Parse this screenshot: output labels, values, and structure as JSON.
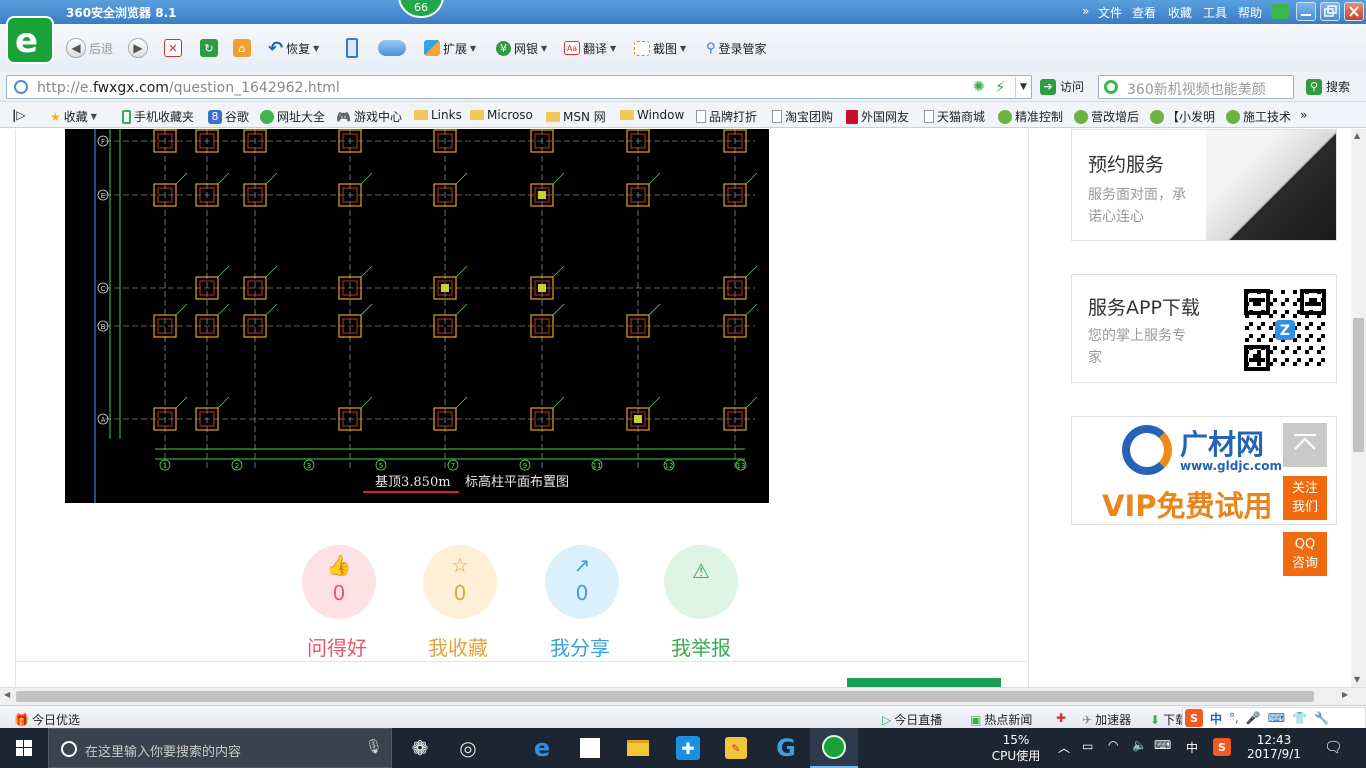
{
  "browser": {
    "title": "360安全浏览器 8.1",
    "badge_count": "66",
    "menu": [
      "文件",
      "查看",
      "收藏",
      "工具",
      "帮助"
    ],
    "colors": {
      "brand": "#1aa23a",
      "titlebar": "#3a7cc4"
    }
  },
  "toolbar": {
    "back_label": "后退",
    "restore_label": "恢复",
    "extend_label": "扩展",
    "bank_label": "网银",
    "translate_label": "翻译",
    "screenshot_label": "截图",
    "login_label": "登录管家"
  },
  "address": {
    "url_prefix": "http://e.",
    "url_domain": "fwxgx.com",
    "url_path": "/question_1642962.html",
    "go_label": "访问",
    "search_placeholder": "360新机视频也能美颜",
    "search_label": "搜索"
  },
  "bookmarks": {
    "favorites_label": "收藏",
    "items": [
      "手机收藏夹",
      "谷歌",
      "网址大全",
      "游戏中心",
      "Links",
      "Microso",
      "MSN 网",
      "Window",
      "品牌打折",
      "淘宝团购",
      "外国网友",
      "天猫商城",
      "精准控制",
      "营改增后",
      "【小发明",
      "施工技术"
    ]
  },
  "drawing": {
    "caption_main": "基顶3.850m",
    "caption_sub": "标高柱平面布置图",
    "row_labels": [
      "F",
      "E",
      "C",
      "B",
      "A"
    ],
    "col_labels": [
      "1",
      "2",
      "3",
      "5",
      "7",
      "9",
      "11",
      "12",
      "13"
    ]
  },
  "actions": [
    {
      "count": "0",
      "label": "问得好",
      "icon": "thumbs-up-icon",
      "color": "#e8566a",
      "bg": "#fde1e4"
    },
    {
      "count": "0",
      "label": "我收藏",
      "icon": "star-icon",
      "color": "#e3a43b",
      "bg": "#fdf0d7"
    },
    {
      "count": "0",
      "label": "我分享",
      "icon": "share-icon",
      "color": "#3ba0dc",
      "bg": "#dcf0fb"
    },
    {
      "count": "0",
      "label": "我举报",
      "icon": "warning-icon",
      "color": "#3bab50",
      "bg": "#dff5e3"
    }
  ],
  "sidebar": {
    "reserve_title": "预约服务",
    "reserve_desc1": "服务面对面，承",
    "reserve_desc2": "诺心连心",
    "app_title": "服务APP下载",
    "app_desc1": "您的掌上服务专",
    "app_desc2": "家",
    "ad_brand": "广材网",
    "ad_url": "www.gldjc.com",
    "ad_slogan": "VIP免费试用",
    "follow_label1": "关注",
    "follow_label2": "我们",
    "qq_label1": "QQ",
    "qq_label2": "咨询"
  },
  "status": {
    "today_label": "今日优选",
    "live_label": "今日直播",
    "news_label": "热点新闻",
    "accel_label": "加速器",
    "download_label": "下载",
    "ime_label": "中"
  },
  "taskbar": {
    "search_placeholder": "在这里输入你要搜索的内容",
    "cpu_percent": "15%",
    "cpu_label": "CPU使用",
    "ime_label": "中",
    "time": "12:43",
    "date": "2017/9/1"
  }
}
